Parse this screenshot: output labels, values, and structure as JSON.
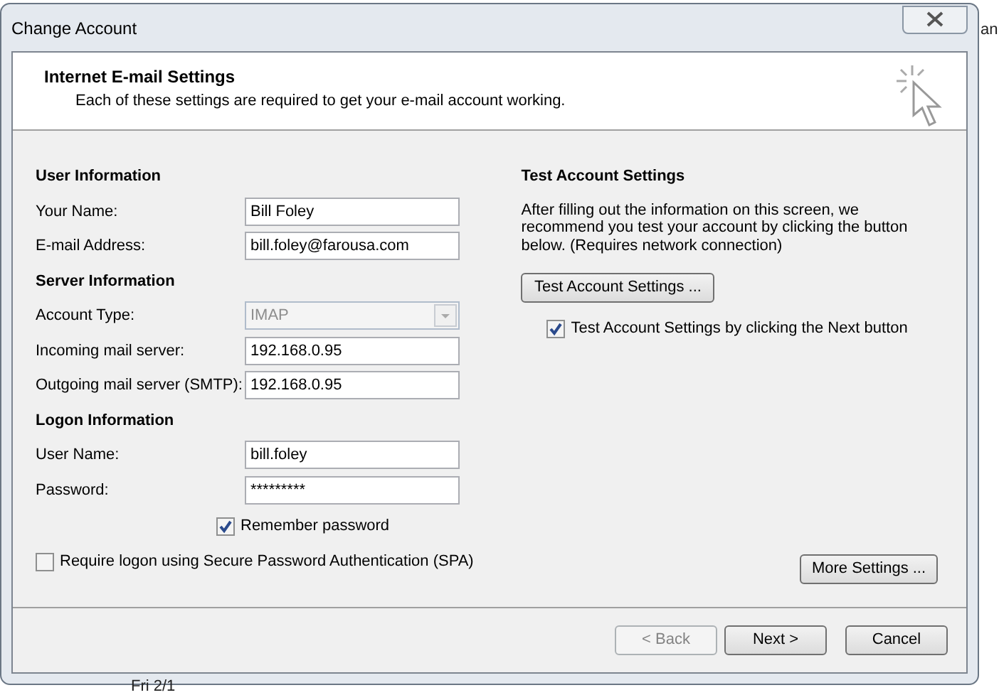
{
  "window": {
    "title": "Change Account"
  },
  "header": {
    "title": "Internet E-mail Settings",
    "subtitle": "Each of these settings are required to get your e-mail account working."
  },
  "sections": [
    {
      "heading": "User Information",
      "fields": [
        {
          "kind": "text",
          "label": "Your Name:",
          "value": "Bill Foley"
        },
        {
          "kind": "text",
          "label": "E-mail Address:",
          "value": "bill.foley@farousa.com"
        }
      ]
    },
    {
      "heading": "Server Information",
      "fields": [
        {
          "kind": "select",
          "label": "Account Type:",
          "value": "IMAP",
          "disabled": true
        },
        {
          "kind": "text",
          "label": "Incoming mail server:",
          "value": "192.168.0.95"
        },
        {
          "kind": "text",
          "label": "Outgoing mail server (SMTP):",
          "value": "192.168.0.95"
        }
      ]
    },
    {
      "heading": "Logon Information",
      "fields": [
        {
          "kind": "text",
          "label": "User Name:",
          "value": "bill.foley"
        },
        {
          "kind": "text",
          "label": "Password:",
          "value": "*********"
        }
      ]
    }
  ],
  "remember_password": {
    "label": "Remember password",
    "checked": true
  },
  "spa": {
    "label": "Require logon using Secure Password Authentication (SPA)",
    "checked": false
  },
  "test": {
    "heading": "Test Account Settings",
    "description": "After filling out the information on this screen, we recommend you test your account by clicking the button below. (Requires network connection)",
    "button": "Test Account Settings ...",
    "checkbox": {
      "label": "Test Account Settings by clicking the Next button",
      "checked": true
    }
  },
  "more_settings": "More Settings ...",
  "buttons": [
    {
      "label": "< Back",
      "disabled": true
    },
    {
      "label": "Next >",
      "disabled": false
    },
    {
      "label": "Cancel",
      "disabled": false
    }
  ],
  "background": [
    "an",
    "Fri 2/1"
  ]
}
